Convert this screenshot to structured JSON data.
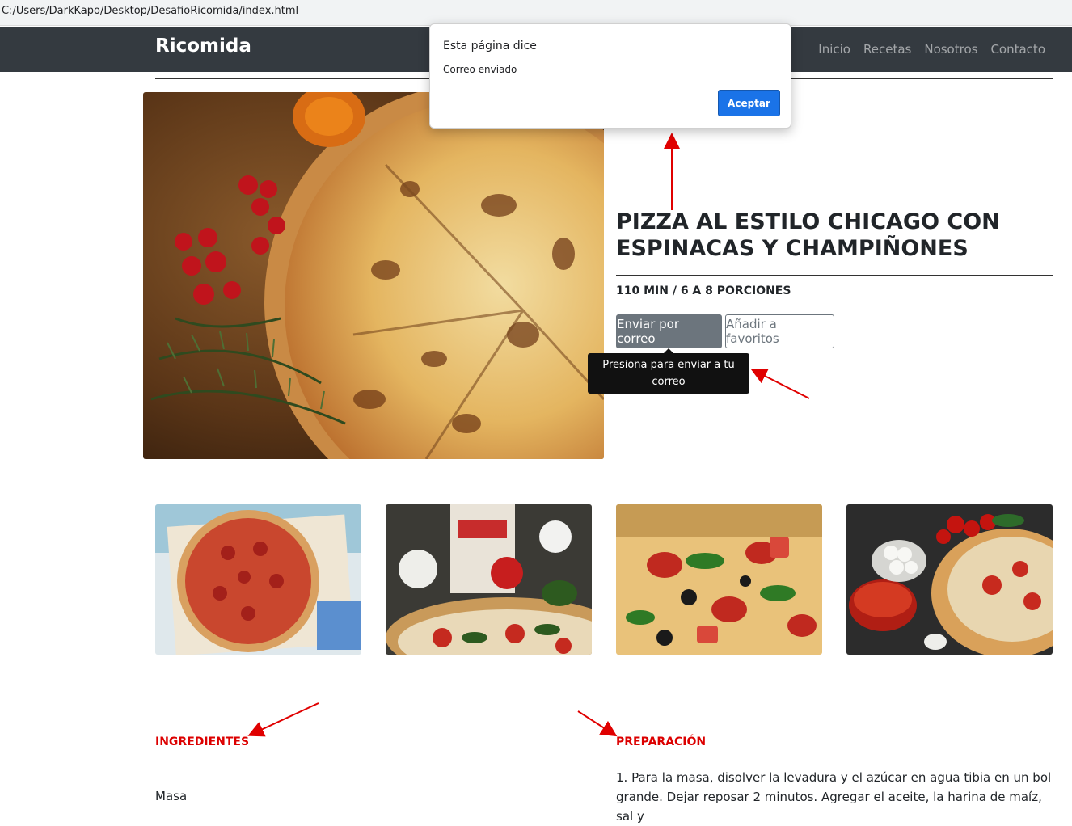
{
  "browser": {
    "url": "C:/Users/DarkKapo/Desktop/DesafioRicomida/index.html"
  },
  "navbar": {
    "brand": "Ricomida",
    "links": [
      "Inicio",
      "Recetas",
      "Nosotros",
      "Contacto"
    ]
  },
  "recipe": {
    "title_line1": "PIZZA AL ESTILO CHICAGO CON",
    "title_line2": "ESPINACAS Y CHAMPIÑONES",
    "meta": "110 MIN / 6 A 8 PORCIONES",
    "send_button": "Enviar por correo",
    "favorite_button": "Añadir a favoritos",
    "tooltip": "Presiona para enviar a tu correo"
  },
  "sections": {
    "ingredients_title": "INGREDIENTES",
    "ingredients_first": "Masa",
    "preparation_title": "PREPARACIÓN",
    "preparation_text": "1. Para la masa, disolver la levadura y el azúcar en agua tibia en un bol grande. Dejar reposar 2 minutos. Agregar el aceite, la harina de maíz, sal y"
  },
  "dialog": {
    "title": "Esta página dice",
    "message": "Correo enviado",
    "accept_button": "Aceptar"
  },
  "colors": {
    "navbar": "#343a40",
    "accent_red": "#dc0000",
    "dialog_button": "#1a73e8"
  }
}
